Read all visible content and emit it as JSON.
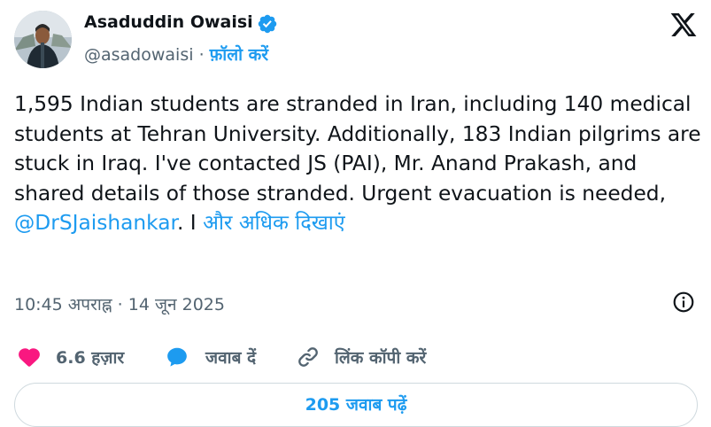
{
  "author": {
    "name": "Asaduddin Owaisi",
    "handle": "@asadowaisi",
    "separator": "·",
    "follow_label": "फ़ॉलो करें"
  },
  "tweet": {
    "text_before_mention": "1,595 Indian students are stranded in Iran, including 140 medical students at Tehran University. Additionally, 183 Indian pilgrims are stuck in Iraq. I've contacted JS (PAI), Mr. Anand Prakash, and shared details of those stranded. Urgent evacuation is needed, ",
    "mention": "@DrSJaishankar",
    "text_after_mention": ". I ",
    "show_more": "और अधिक दिखाएं"
  },
  "meta": {
    "timestamp": "10:45 अपराह्न · 14 जून 2025"
  },
  "actions": {
    "likes_count": "6.6 हज़ार",
    "reply_label": "जवाब दें",
    "copy_link_label": "लिंक कॉपी करें"
  },
  "footer": {
    "read_replies_label": "205 जवाब पढ़ें"
  },
  "colors": {
    "link": "#1d9bf0",
    "like": "#f91880",
    "verified": "#1d9bf0",
    "muted": "#536471"
  },
  "icons": [
    "x-logo-icon",
    "verified-badge-icon",
    "info-icon",
    "heart-icon",
    "reply-bubble-icon",
    "link-icon"
  ]
}
